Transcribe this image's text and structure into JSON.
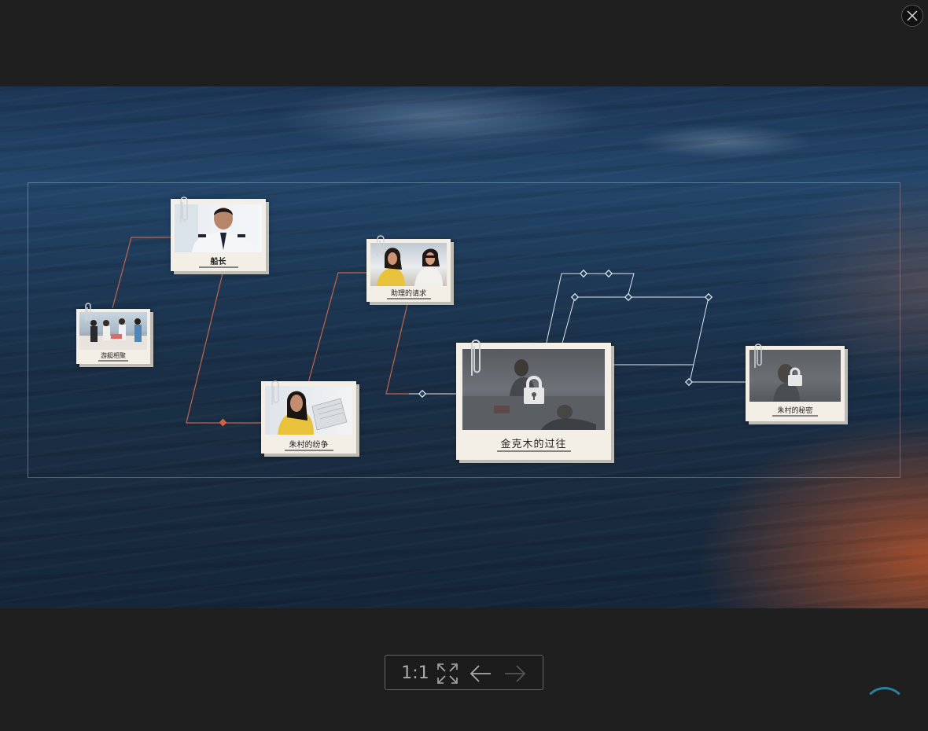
{
  "viewer": {
    "close_icon": "close-icon",
    "toolbar": {
      "ratio_label": "1:1",
      "fullscreen_icon": "expand-icon",
      "prev_icon": "arrow-left-icon",
      "next_icon": "arrow-right-icon"
    }
  },
  "story_map": {
    "nodes": {
      "yacht": {
        "caption": "游艇相聚",
        "locked": false
      },
      "captain": {
        "caption": "船长",
        "locked": false
      },
      "zhucun": {
        "caption": "朱村的纷争",
        "locked": false
      },
      "assistant": {
        "caption": "助理的请求",
        "locked": false
      },
      "jinkemu": {
        "caption": "金克木的过往",
        "locked": true
      },
      "zhucun_secret": {
        "caption": "朱村的秘密",
        "locked": true
      }
    },
    "colors": {
      "link_orange": "#c2654a",
      "link_white": "#dfe6ee",
      "card_paper": "#f3efe6"
    }
  }
}
